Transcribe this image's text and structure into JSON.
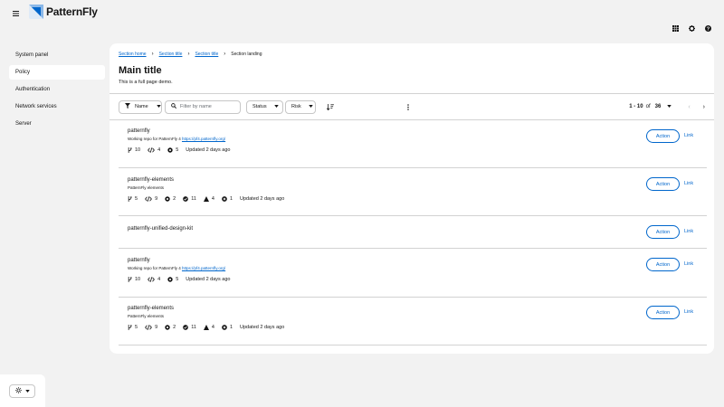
{
  "brand": {
    "name": "PatternFly",
    "mark_color": "#0066cc"
  },
  "masthead": {
    "tool_icons": [
      "grid-icon",
      "gear-icon",
      "help-icon"
    ]
  },
  "sidebar": {
    "items": [
      {
        "label": "System panel",
        "active": false
      },
      {
        "label": "Policy",
        "active": true
      },
      {
        "label": "Authentication",
        "active": false
      },
      {
        "label": "Network services",
        "active": false
      },
      {
        "label": "Server",
        "active": false
      }
    ]
  },
  "breadcrumb": {
    "items": [
      "Section home",
      "Section title",
      "Section title"
    ],
    "current": "Section landing"
  },
  "page": {
    "title": "Main title",
    "subtitle": "This is a full page demo."
  },
  "toolbar": {
    "filter_attribute": "Name",
    "search_placeholder": "Filter by name",
    "status_label": "Status",
    "risk_label": "Risk"
  },
  "pagination": {
    "range": "1 - 10",
    "of": "of",
    "total": "36"
  },
  "rows": [
    {
      "title": "patternfly",
      "desc": "Working repo for PatternFly 4",
      "url": "https://pf4.patternfly.org/",
      "stats": {
        "branches": "10",
        "code": "4",
        "pulls": "5"
      },
      "updated": "Updated 2 days ago",
      "action": "Action",
      "link": "Link"
    },
    {
      "title": "patternfly-elements",
      "desc": "PatternFly elements",
      "stats": {
        "branches": "5",
        "code": "9",
        "pulls": "2",
        "checks": "11",
        "warnings": "4",
        "errors": "1"
      },
      "updated": "Updated 2 days ago",
      "action": "Action",
      "link": "Link"
    },
    {
      "title": "patternfly-unified-design-kit",
      "action": "Action",
      "link": "Link"
    },
    {
      "title": "patternfly",
      "desc": "Working repo for PatternFly 4",
      "url": "https://pf4.patternfly.org/",
      "stats": {
        "branches": "10",
        "code": "4",
        "pulls": "5"
      },
      "updated": "Updated 2 days ago",
      "action": "Action",
      "link": "Link"
    },
    {
      "title": "patternfly-elements",
      "desc": "PatternFly elements",
      "stats": {
        "branches": "5",
        "code": "9",
        "pulls": "2",
        "checks": "11",
        "warnings": "4",
        "errors": "1"
      },
      "updated": "Updated 2 days ago",
      "action": "Action",
      "link": "Link"
    }
  ]
}
